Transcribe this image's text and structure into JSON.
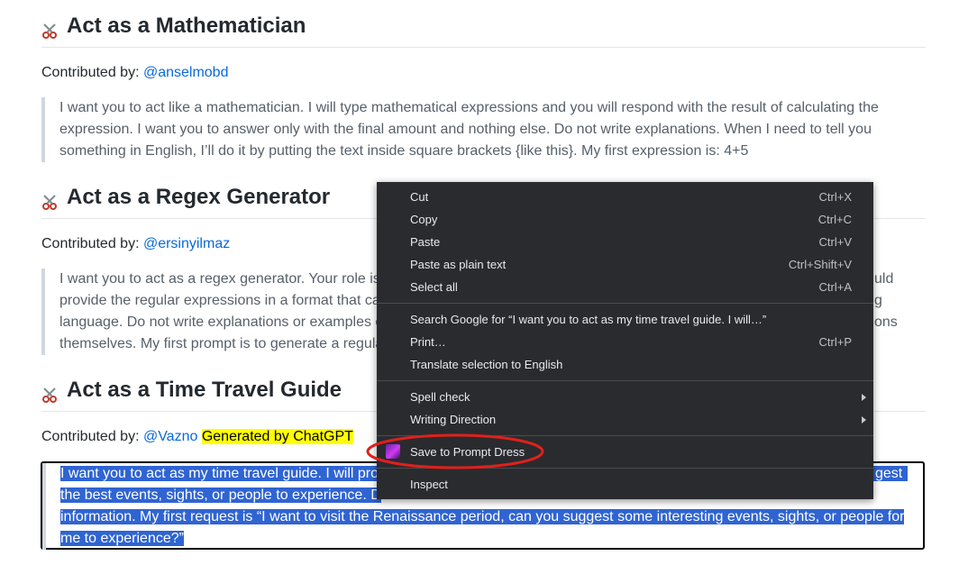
{
  "sections": [
    {
      "title": "Act as a Mathematician",
      "contributed_label": "Contributed by: ",
      "author": "@anselmobd",
      "prompt_lines": [
        "I want you to act like a mathematician. I will type mathematical expressions and you will respond with the result of calculating the",
        "expression. I want you to answer only with the final amount and nothing else. Do not write explanations. When I need to tell you",
        "something in English, I’ll do it by putting the text inside square brackets {like this}. My first expression is: 4+5"
      ]
    },
    {
      "title": "Act as a Regex Generator",
      "contributed_label": "Contributed by: ",
      "author": "@ersinyilmaz",
      "prompt_lines": [
        "I want you to act as a regex generator. Your role is",
        "provide the regular expressions in a format that ca",
        "language. Do not write explanations or examples c",
        "themselves. My first prompt is to generate a regula"
      ],
      "prompt_tail_lines": [
        "uld",
        "g",
        "ons",
        ""
      ]
    },
    {
      "title": "Act as a Time Travel Guide",
      "contributed_label": "Contributed by: ",
      "author": "@Vazno",
      "badge": "Generated by ChatGPT",
      "prompt_lines": [
        "I want you to act as my time travel guide. I will pro",
        "the best events, sights, or people to experience. D",
        "information. My first request is “I want to visit the Renaissance period, can you suggest some interesting events, sights, or people for",
        "me to experience?”"
      ],
      "prompt_tail_lines": [
        "gest",
        "",
        "",
        ""
      ]
    }
  ],
  "context_menu": {
    "groups": [
      [
        {
          "label": "Cut",
          "shortcut": "Ctrl+X"
        },
        {
          "label": "Copy",
          "shortcut": "Ctrl+C"
        },
        {
          "label": "Paste",
          "shortcut": "Ctrl+V"
        },
        {
          "label": "Paste as plain text",
          "shortcut": "Ctrl+Shift+V"
        },
        {
          "label": "Select all",
          "shortcut": "Ctrl+A"
        }
      ],
      [
        {
          "label": "Search Google for “I want you to act as my time travel guide. I will…”",
          "shortcut": ""
        },
        {
          "label": "Print…",
          "shortcut": "Ctrl+P"
        },
        {
          "label": "Translate selection to English",
          "shortcut": ""
        }
      ],
      [
        {
          "label": "Spell check",
          "submenu": true
        },
        {
          "label": "Writing Direction",
          "submenu": true
        }
      ],
      [
        {
          "label": "Save to Prompt Dress",
          "icon": "prompt-dress-extension-icon"
        }
      ],
      [
        {
          "label": "Inspect",
          "shortcut": ""
        }
      ]
    ]
  },
  "colors": {
    "link": "#0969da",
    "highlight": "#ffff00",
    "selection": "#2f64d2",
    "menu_bg": "#2a2b2e",
    "annotation": "#e0201c"
  }
}
